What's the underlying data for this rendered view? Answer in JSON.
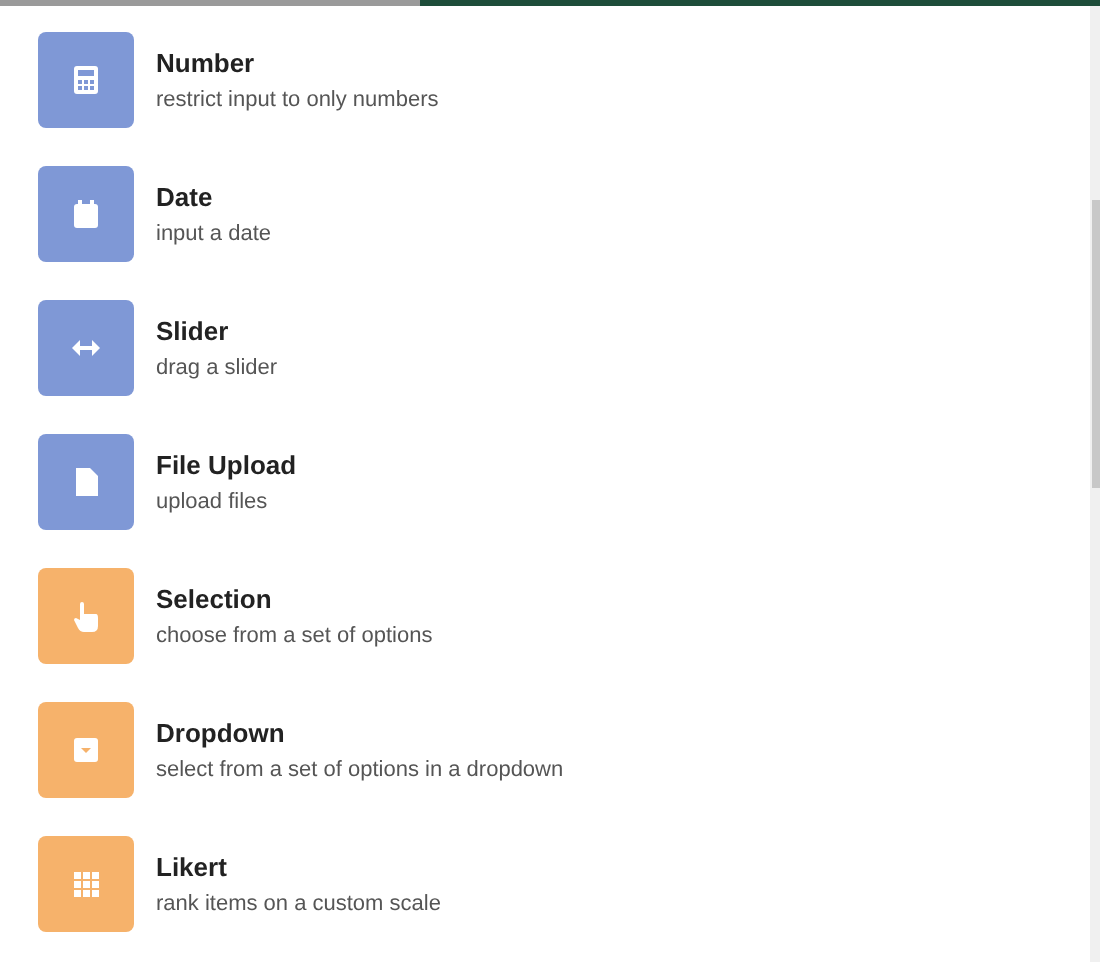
{
  "field_types": [
    {
      "kind": "calculator",
      "color": "#7f98d6",
      "title": "Number",
      "description": "restrict input to only numbers"
    },
    {
      "kind": "calendar",
      "color": "#7f98d6",
      "title": "Date",
      "description": "input a date"
    },
    {
      "kind": "arrows",
      "color": "#7f98d6",
      "title": "Slider",
      "description": "drag a slider"
    },
    {
      "kind": "file",
      "color": "#7f98d6",
      "title": "File Upload",
      "description": "upload files"
    },
    {
      "kind": "hand",
      "color": "#f6b26b",
      "title": "Selection",
      "description": "choose from a set of options"
    },
    {
      "kind": "dropdown",
      "color": "#f6b26b",
      "title": "Dropdown",
      "description": "select from a set of options in a dropdown"
    },
    {
      "kind": "grid",
      "color": "#f6b26b",
      "title": "Likert",
      "description": "rank items on a custom scale"
    }
  ]
}
